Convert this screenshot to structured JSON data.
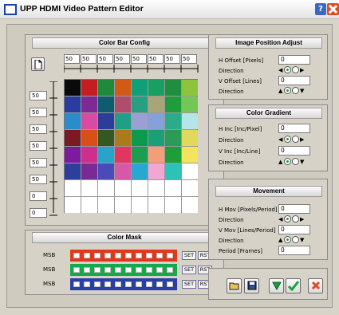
{
  "title": "UPP HDMI Video Pattern Editor",
  "help_label": "?",
  "colorbar": {
    "header": "Color Bar Config",
    "columns": [
      "50",
      "50",
      "50",
      "50",
      "50",
      "50",
      "50",
      "50"
    ],
    "rows": [
      "50",
      "50",
      "50",
      "50",
      "50",
      "50",
      "0",
      "0"
    ],
    "grid": [
      [
        "#0a0a0a",
        "#c41e23",
        "#1d8a3c",
        "#d15a16",
        "#10a079",
        "#17a062",
        "#1f8f3d",
        "#8fc33b"
      ],
      [
        "#2a3d9e",
        "#7e2a95",
        "#0f5c6e",
        "#b04d6e",
        "#27a082",
        "#a8a578",
        "#1f9d3d",
        "#74c754"
      ],
      [
        "#2b8ccc",
        "#d94aa1",
        "#2b3d98",
        "#1f9e88",
        "#9a9fd4",
        "#86a1d9",
        "#2aac8a",
        "#b5e5e8"
      ],
      [
        "#7a1a22",
        "#d94f1a",
        "#34581f",
        "#ad7a1b",
        "#0c9a4e",
        "#1b9f74",
        "#2b9c57",
        "#e2d85c"
      ],
      [
        "#7d1aa0",
        "#cf2f8c",
        "#29a3c8",
        "#e33562",
        "#1d9d4f",
        "#f49e78",
        "#1d9e38",
        "#f3e45c"
      ],
      [
        "#2c3f9c",
        "#7a2a94",
        "#4a4bb8",
        "#d658a6",
        "#27a8d0",
        "#f2a6d2",
        "#2bc2b8",
        "#ffffff"
      ],
      [
        "#ffffff",
        "#ffffff",
        "#ffffff",
        "#ffffff",
        "#ffffff",
        "#ffffff",
        "#ffffff",
        "#ffffff"
      ],
      [
        "#ffffff",
        "#ffffff",
        "#ffffff",
        "#ffffff",
        "#ffffff",
        "#ffffff",
        "#ffffff",
        "#ffffff"
      ]
    ]
  },
  "colormask": {
    "header": "Color Mask",
    "rows": [
      {
        "label": "MSB",
        "color": "#e0381f"
      },
      {
        "label": "MSB",
        "color": "#16a84a"
      },
      {
        "label": "MSB",
        "color": "#2a3ea8"
      }
    ],
    "set_label": "SET",
    "rst_label": "RST"
  },
  "position": {
    "header": "Image Position Adjust",
    "h_label": "H Offset [Pixels]",
    "h_value": "0",
    "dir1_label": "Direction",
    "v_label": "V Offset [Lines]",
    "v_value": "0",
    "dir2_label": "Direction"
  },
  "gradient": {
    "header": "Color Gradient",
    "h_label": "H Inc [Inc/Pixel]",
    "h_value": "0",
    "dir1_label": "Direction",
    "v_label": "V Inc [Inc/Line]",
    "v_value": "0",
    "dir2_label": "Direction"
  },
  "movement": {
    "header": "Movement",
    "h_label": "H Mov [Pixels/Period]",
    "h_value": "0",
    "dir1_label": "Direction",
    "v_label": "V Mov [Lines/Period]",
    "v_value": "0",
    "dir2_label": "Direction",
    "period_label": "Period [Frames]",
    "period_value": "0"
  },
  "accent": "#1c3fa8"
}
